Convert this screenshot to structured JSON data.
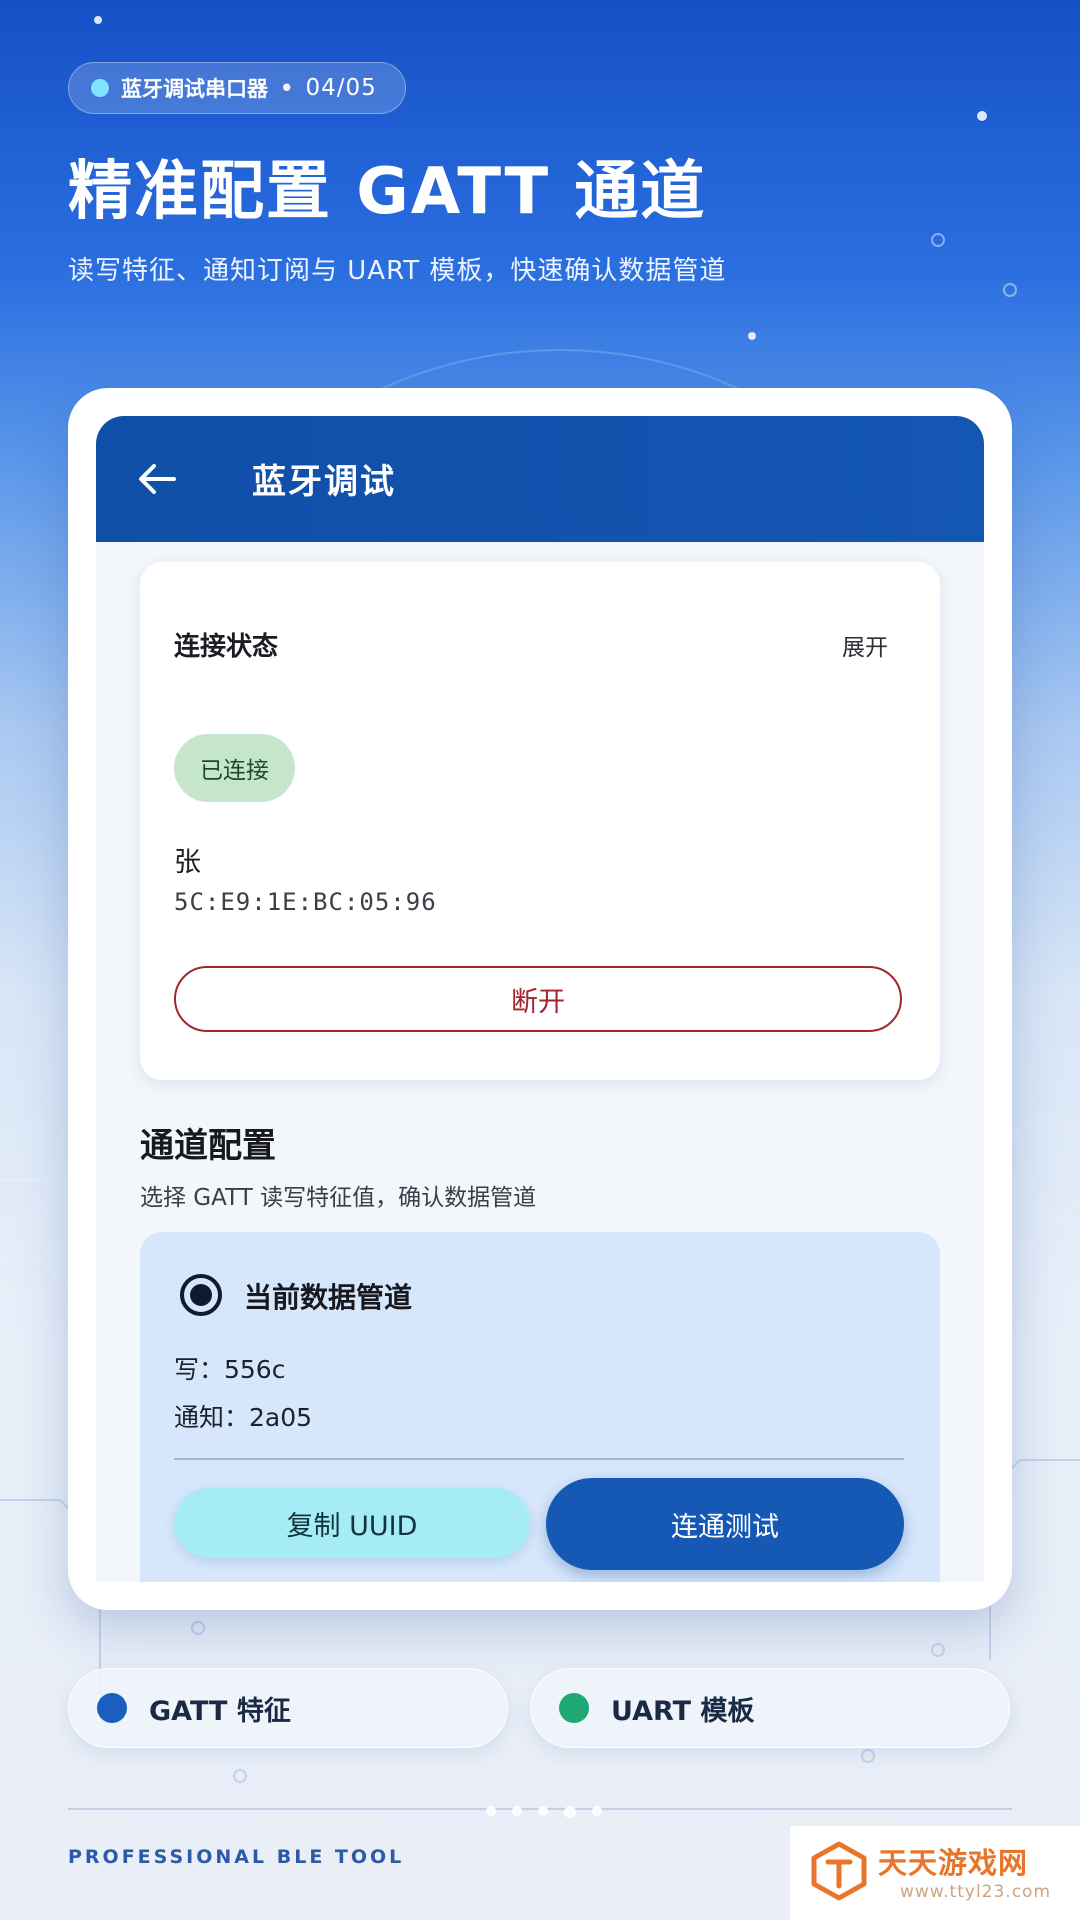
{
  "header": {
    "pill_label": "蓝牙调试串口器",
    "pill_separator": "•",
    "pager": "04/05",
    "headline": "精准配置 GATT 通道",
    "subline": "读写特征、通知订阅与 UART 模板，快速确认数据管道"
  },
  "app": {
    "title": "蓝牙调试",
    "back_icon": "arrow-left-icon",
    "connection": {
      "title": "连接状态",
      "expand_label": "展开",
      "status_badge": "已连接",
      "device_name": "张",
      "mac": "5C:E9:1E:BC:05:96",
      "disconnect_label": "断开"
    },
    "channel": {
      "section_title": "通道配置",
      "section_subtitle": "选择 GATT 读写特征值，确认数据管道",
      "card_title": "当前数据管道",
      "write_row": "写：556c",
      "notify_row": "通知：2a05",
      "copy_label": "复制 UUID",
      "test_label": "连通测试",
      "radio_selected": true
    }
  },
  "chips": [
    {
      "label": "GATT 特征",
      "dot_color": "#1a5fc0"
    },
    {
      "label": "UART 模板",
      "dot_color": "#1fa873"
    }
  ],
  "footer": {
    "brand": "PROFESSIONAL BLE TOOL",
    "page_dots": 5,
    "active_dot": 4
  },
  "watermark": {
    "name": "天天游戏网",
    "url": "www.ttyl23.com"
  },
  "colors": {
    "accent_blue": "#1559b4",
    "disconnect_red": "#a1262e",
    "connected_green_bg": "#c6e6cc",
    "copy_button_bg": "#a6ecf7",
    "channel_card_bg": "#d6e6fb"
  }
}
